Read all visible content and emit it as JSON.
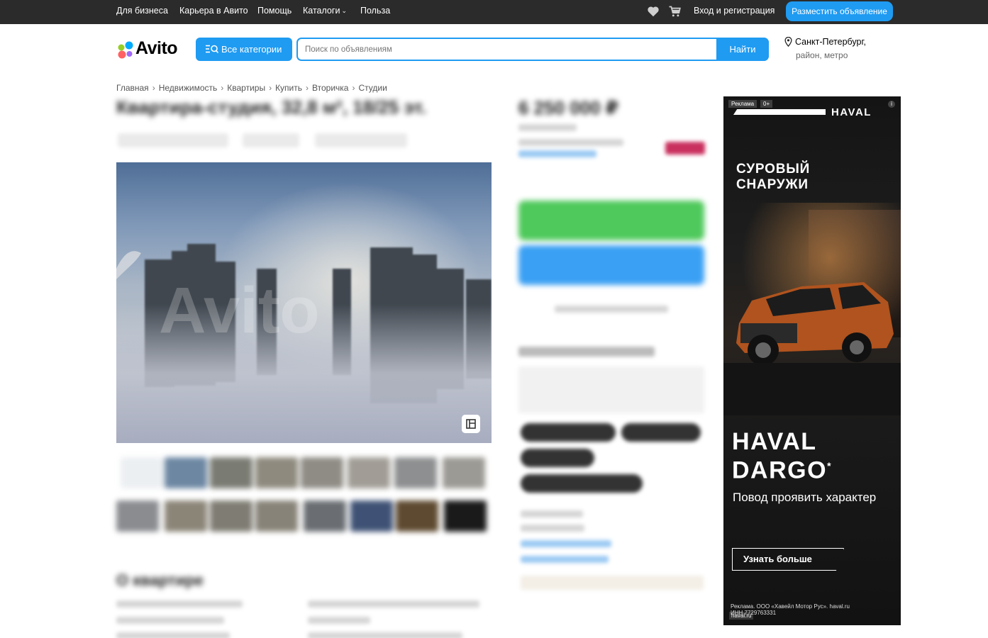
{
  "topbar": {
    "links": [
      "Для бизнеса",
      "Карьера в Авито",
      "Помощь",
      "Каталоги",
      "Польза"
    ],
    "login": "Вход и регистрация",
    "post_button": "Разместить объявление"
  },
  "header": {
    "logo_text": "Avito",
    "categories_button": "Все категории",
    "search_placeholder": "Поиск по объявлениям",
    "search_button": "Найти",
    "location_city": "Санкт-Петербург,",
    "location_sub": "район, метро"
  },
  "breadcrumb": [
    "Главная",
    "Недвижимость",
    "Квартиры",
    "Купить",
    "Вторичка",
    "Студии"
  ],
  "listing": {
    "title": "Квартира-студия, 32,8 м², 18/25 эт.",
    "price": "6 250 000 ₽",
    "watermark": "Avito",
    "section_title": "О квартире"
  },
  "ad": {
    "label": "Реклама",
    "age": "0+",
    "brand": "HAVAL",
    "slogan": "СУРОВЫЙ СНАРУЖИ",
    "model": "HAVAL DARGO",
    "model_mark": "*",
    "subtitle": "Повод проявить характер",
    "cta": "Узнать больше",
    "legal": "Реклама. ООО «Хавейл Мотор Рус». haval.ru",
    "legal_id": "ИНН 7729763331",
    "site": "haval.ru"
  },
  "colors": {
    "accent": "#1f9bf2",
    "topbar": "#2b2b2b",
    "green": "#4fc95b",
    "ad_bg": "#141414"
  },
  "icons": [
    "heart-icon",
    "cart-icon",
    "search-icon",
    "location-pin-icon",
    "gallery-icon",
    "info-icon"
  ]
}
